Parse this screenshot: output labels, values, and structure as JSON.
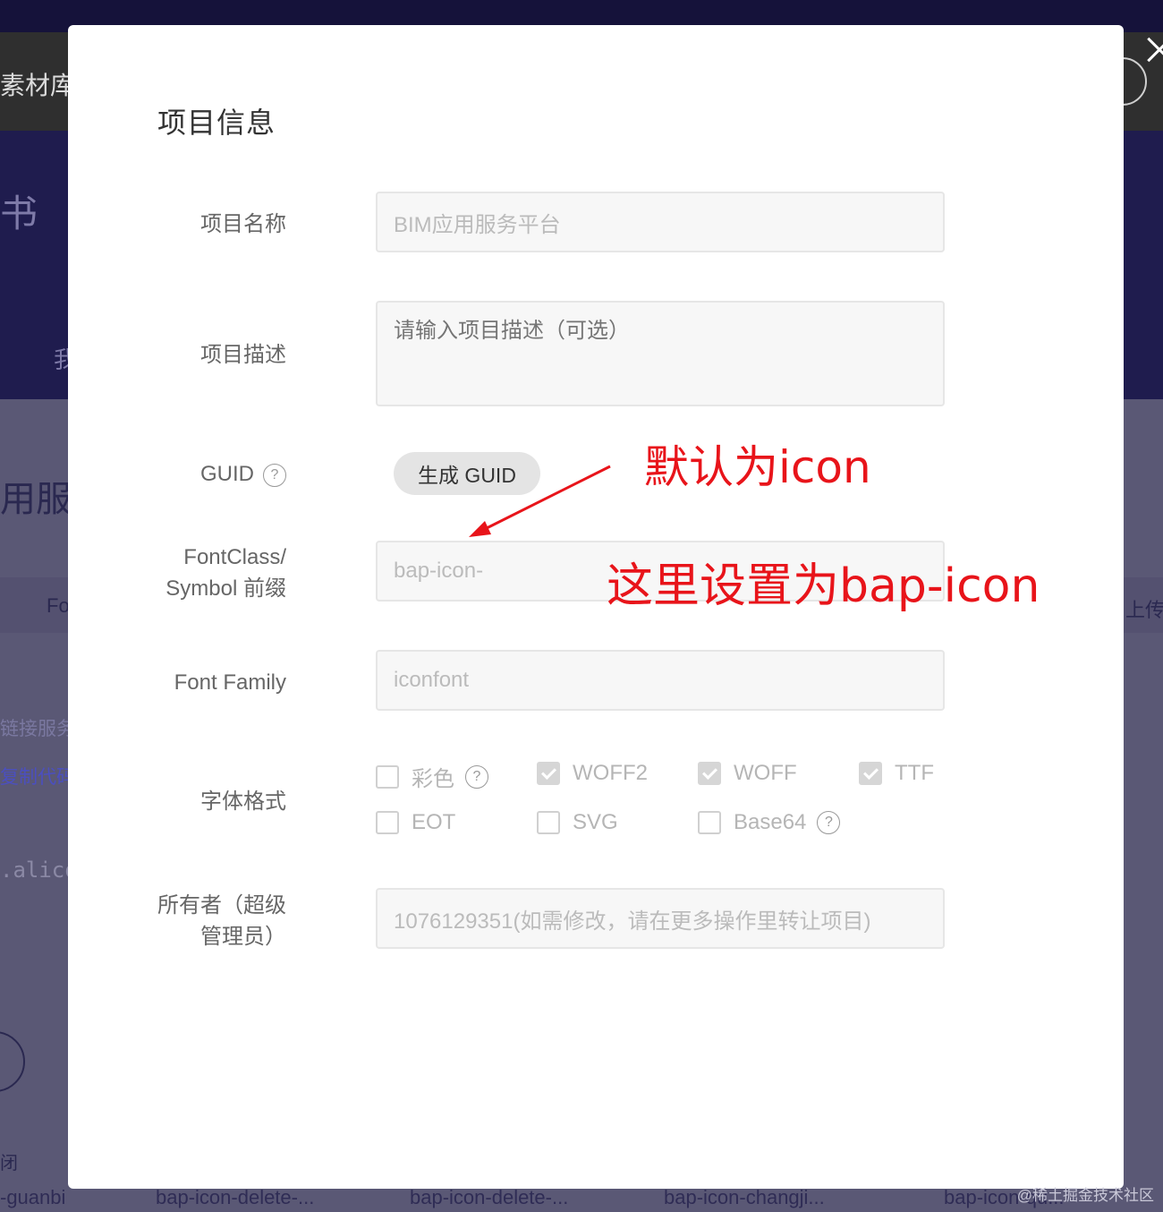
{
  "background": {
    "nav_text": "素材库",
    "hero_text": "书",
    "hero_small": "我",
    "title_fragment": "用服务",
    "tab_left": "Fo",
    "tab_right": "上传图",
    "link1": "链接服务",
    "link2": "复制代码",
    "code_fragment": ".alico",
    "close_fragment": "闭",
    "icon_names": [
      "-guanbi",
      "bap-icon-delete-...",
      "bap-icon-delete-...",
      "bap-icon-changji...",
      "bap-icon-qu..."
    ],
    "watermark": "@稀土掘金技术社区"
  },
  "modal": {
    "title": "项目信息",
    "fields": {
      "name": {
        "label": "项目名称",
        "value": "BIM应用服务平台"
      },
      "description": {
        "label": "项目描述",
        "placeholder": "请输入项目描述（可选）"
      },
      "guid": {
        "label": "GUID",
        "button": "生成 GUID",
        "help": "?"
      },
      "prefix": {
        "label_line1": "FontClass/",
        "label_line2": "Symbol 前缀",
        "value": "bap-icon-"
      },
      "font_family": {
        "label": "Font Family",
        "value": "iconfont"
      },
      "font_format": {
        "label": "字体格式",
        "options": [
          {
            "label": "彩色",
            "checked": false,
            "help": "?"
          },
          {
            "label": "WOFF2",
            "checked": true
          },
          {
            "label": "WOFF",
            "checked": true
          },
          {
            "label": "TTF",
            "checked": true
          },
          {
            "label": "EOT",
            "checked": false
          },
          {
            "label": "SVG",
            "checked": false
          },
          {
            "label": "Base64",
            "checked": false,
            "help": "?"
          }
        ]
      },
      "owner": {
        "label_line1": "所有者（超级",
        "label_line2": "管理员）",
        "value": "1076129351(如需修改，请在更多操作里转让项目)"
      }
    }
  },
  "annotations": {
    "default_note": "默认为icon",
    "set_note": "这里设置为bap-icon",
    "color": "#e8141a"
  }
}
